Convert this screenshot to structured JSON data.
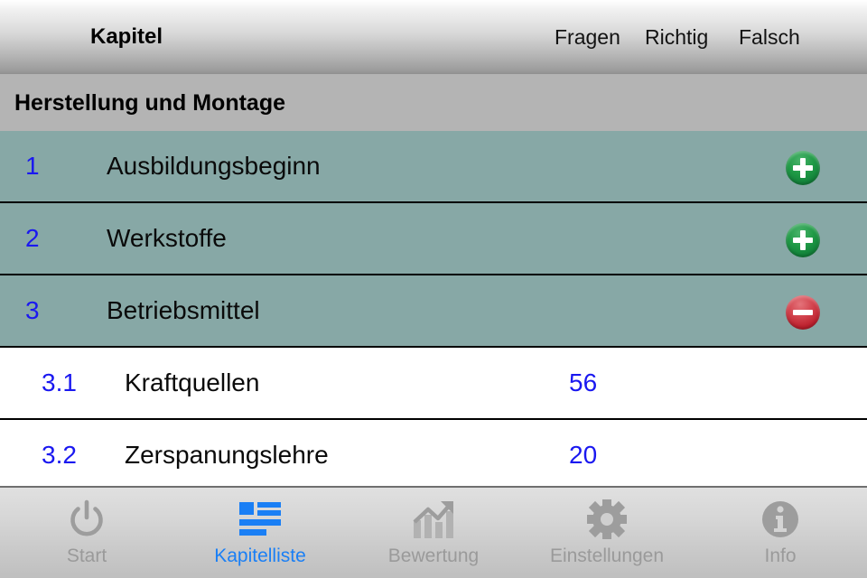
{
  "navbar": {
    "title": "Kapitel",
    "columns": [
      {
        "label": "Fragen"
      },
      {
        "label": "Richtig"
      },
      {
        "label": "Falsch"
      }
    ]
  },
  "section": {
    "title": "Herstellung und Montage"
  },
  "list": {
    "rows": [
      {
        "number": "1",
        "label": "Ausbildungsbeginn",
        "count": "",
        "badge": "plus-icon",
        "level": "chapter"
      },
      {
        "number": "2",
        "label": "Werkstoffe",
        "count": "",
        "badge": "plus-icon",
        "level": "chapter"
      },
      {
        "number": "3",
        "label": "Betriebsmittel",
        "count": "",
        "badge": "minus-icon",
        "level": "chapter"
      },
      {
        "number": "3.1",
        "label": "Kraftquellen",
        "count": "56",
        "badge": "",
        "level": "sub"
      },
      {
        "number": "3.2",
        "label": "Zerspanungslehre",
        "count": "20",
        "badge": "",
        "level": "sub"
      }
    ]
  },
  "tabbar": {
    "tabs": [
      {
        "label": "Start",
        "icon": "power-icon",
        "active": false
      },
      {
        "label": "Kapitelliste",
        "icon": "list-icon",
        "active": true
      },
      {
        "label": "Bewertung",
        "icon": "chart-up-icon",
        "active": false
      },
      {
        "label": "Einstellungen",
        "icon": "gear-icon",
        "active": false
      },
      {
        "label": "Info",
        "icon": "info-icon",
        "active": false
      }
    ]
  },
  "colors": {
    "chapter_row": "#87a8a6",
    "section_header": "#b4b4b4",
    "accent_blue": "#1a18f0",
    "tab_active": "#1a7ff5",
    "badge_green": "#1f9a46",
    "badge_red": "#bb1f2c"
  }
}
